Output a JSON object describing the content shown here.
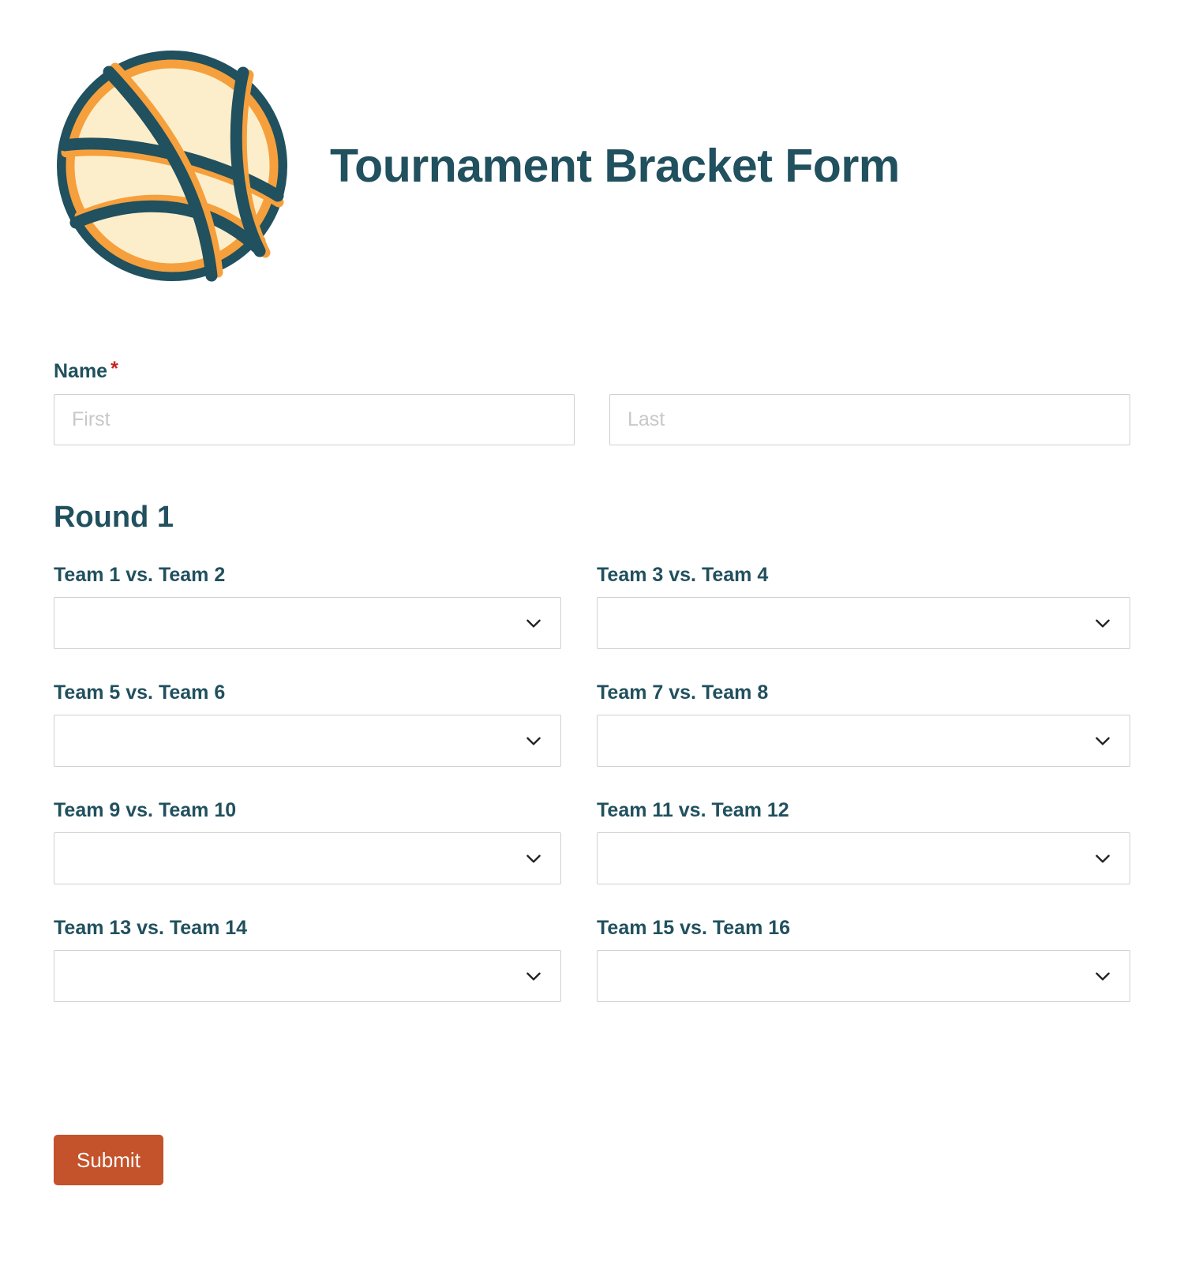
{
  "header": {
    "title": "Tournament Bracket Form",
    "logo_icon": "basketball-icon",
    "colors": {
      "ball_outline": "#21505e",
      "ball_seam": "#f5a03c",
      "ball_fill": "#fdeecb"
    }
  },
  "theme": {
    "accent": "#21505e",
    "submit_bg": "#c4522a",
    "required_star": "#c32525",
    "border": "#cfcfcf",
    "placeholder": "#c8c8c8"
  },
  "name_field": {
    "label": "Name",
    "required_marker": "*",
    "first": {
      "value": "",
      "placeholder": "First"
    },
    "last": {
      "value": "",
      "placeholder": "Last"
    }
  },
  "round": {
    "heading": "Round 1",
    "matchups": [
      {
        "label": "Team 1 vs. Team 2",
        "value": "",
        "icon": "chevron-down-icon"
      },
      {
        "label": "Team 3 vs. Team 4",
        "value": "",
        "icon": "chevron-down-icon"
      },
      {
        "label": "Team 5 vs. Team 6",
        "value": "",
        "icon": "chevron-down-icon"
      },
      {
        "label": "Team 7 vs. Team 8",
        "value": "",
        "icon": "chevron-down-icon"
      },
      {
        "label": "Team 9 vs. Team 10",
        "value": "",
        "icon": "chevron-down-icon"
      },
      {
        "label": "Team 11 vs. Team 12",
        "value": "",
        "icon": "chevron-down-icon"
      },
      {
        "label": "Team 13 vs. Team 14",
        "value": "",
        "icon": "chevron-down-icon"
      },
      {
        "label": "Team 15 vs. Team 16",
        "value": "",
        "icon": "chevron-down-icon"
      }
    ]
  },
  "footer": {
    "submit_label": "Submit"
  }
}
